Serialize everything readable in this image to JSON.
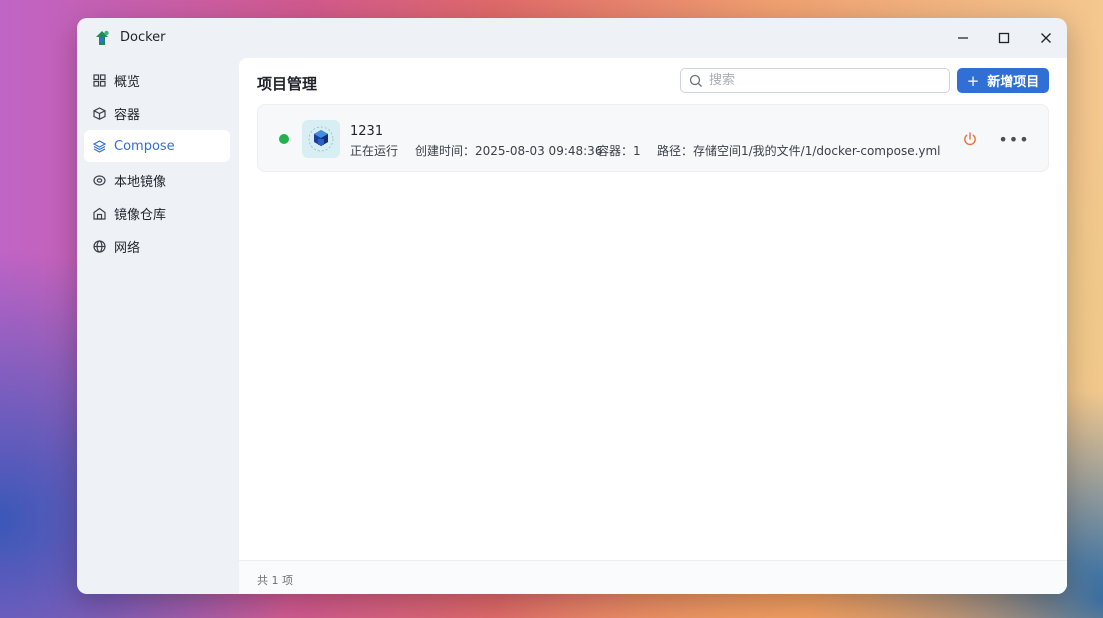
{
  "window": {
    "title": "Docker",
    "logo_icon": "docker-logo",
    "controls": [
      "minimize-icon",
      "maximize-icon",
      "close-icon"
    ]
  },
  "sidebar": {
    "items": [
      {
        "label": "概览",
        "icon": "grid-icon",
        "active": false
      },
      {
        "label": "容器",
        "icon": "cube-icon",
        "active": false
      },
      {
        "label": "Compose",
        "icon": "layers-icon",
        "active": true
      },
      {
        "label": "本地镜像",
        "icon": "disc-icon",
        "active": false
      },
      {
        "label": "镜像仓库",
        "icon": "warehouse-icon",
        "active": false
      },
      {
        "label": "网络",
        "icon": "globe-icon",
        "active": false
      }
    ]
  },
  "main": {
    "title": "项目管理",
    "search": {
      "placeholder": "搜索",
      "value": ""
    },
    "add_button_label": "新增项目",
    "projects": [
      {
        "name": "1231",
        "status": "正在运行",
        "status_color": "#22b14c",
        "created": "创建时间：2025-08-03 09:48:36",
        "containers": "容器：1",
        "path": "路径：存储空间1/我的文件/1/docker-compose.yml"
      }
    ],
    "footer_count": "共 1 项"
  },
  "colors": {
    "accent": "#2f6fd6",
    "running": "#22b14c",
    "power": "#e8743b"
  }
}
